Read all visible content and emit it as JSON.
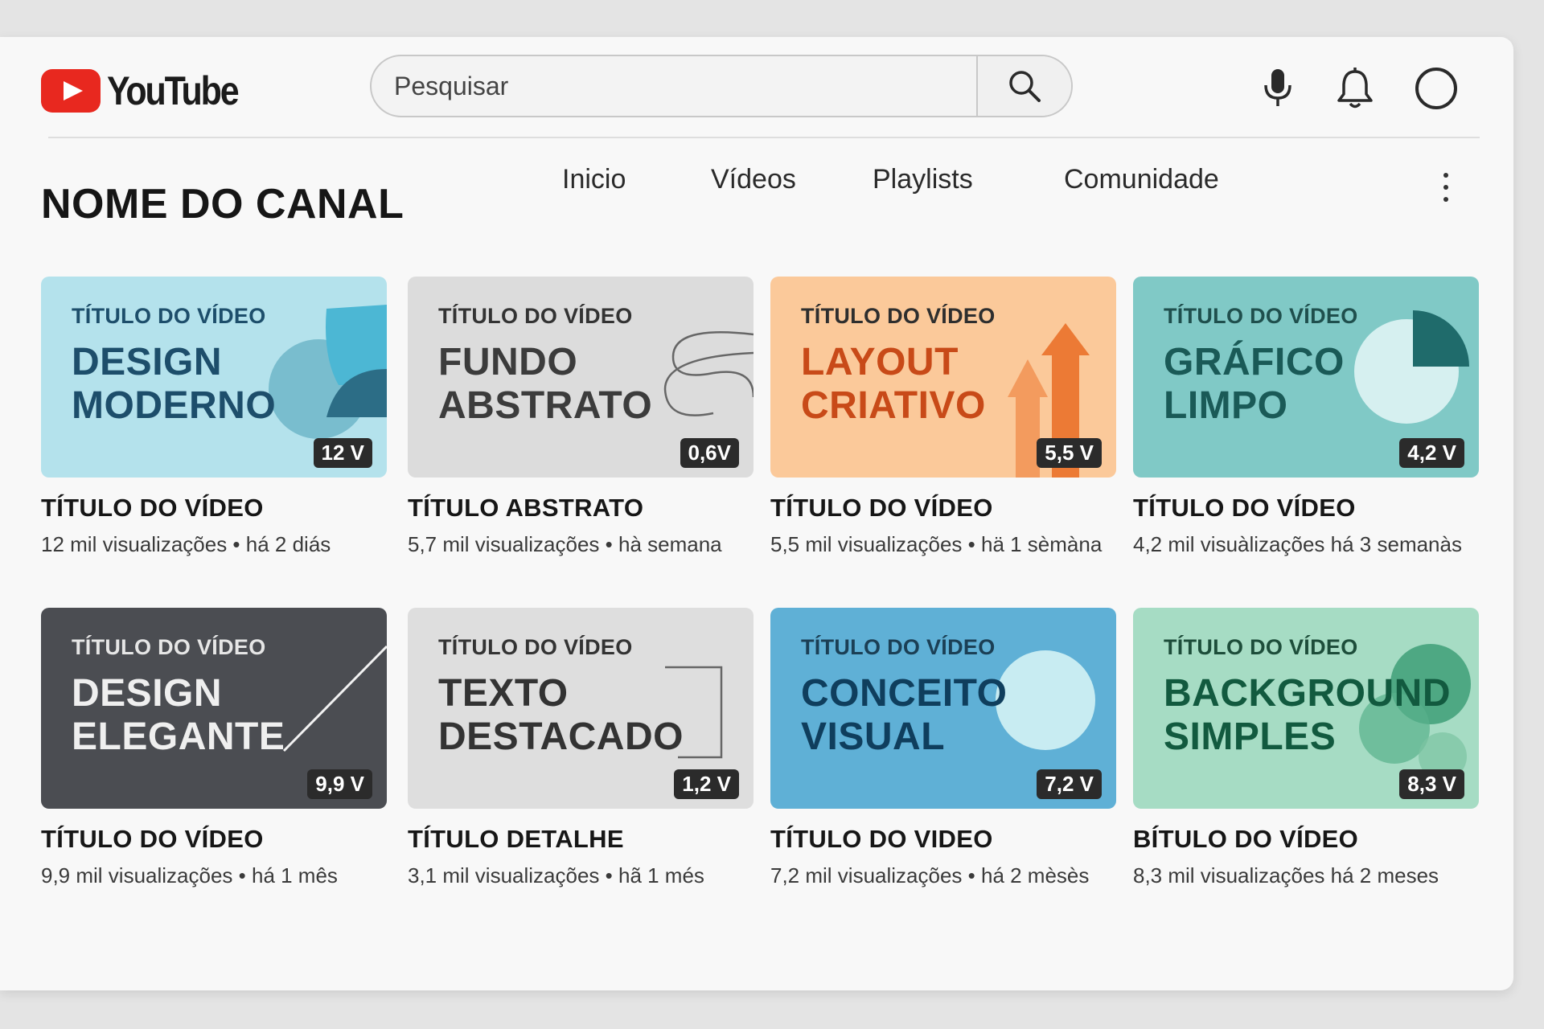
{
  "header": {
    "logo_text": "YouTube",
    "search_placeholder": "Pesquisar",
    "icons": [
      "microphone-icon",
      "bell-icon",
      "account-circle-icon"
    ]
  },
  "channel": {
    "name": "NOME DO CANAL",
    "tabs": [
      "Inicio",
      "Vídeos",
      "Playlists",
      "Comunidade"
    ]
  },
  "videos": [
    {
      "kicker": "TÍTULO DO VÍDEO",
      "headline": "DESIGN\nMODERNO",
      "duration": "12 V",
      "title": "TÍTULO DO VÍDEO",
      "meta": "12 mil visualizações  •  há 2 diás",
      "bg": "#b4e2ec",
      "fg": "#1d4e6b",
      "kicker_color": "#1d4e6b"
    },
    {
      "kicker": "TÍTULO DO VÍDEO",
      "headline": "FUNDO\nABSTRATO",
      "duration": "0,6V",
      "title": "TÍTULO ABSTRATO",
      "meta": "5,7 mil visualizações  •  hà semana",
      "bg": "#dcdcdc",
      "fg": "#3c3c3c",
      "kicker_color": "#333333"
    },
    {
      "kicker": "TÍTULO DO VÍDEO",
      "headline": "LAYOUT\nCRIATIVO",
      "duration": "5,5 V",
      "title": "TÍTULO DO VÍDEO",
      "meta": "5,5 mil visualizações  •  hä 1 sèmàna",
      "bg": "#fbc99a",
      "fg": "#c84a18",
      "kicker_color": "#2e2e2e"
    },
    {
      "kicker": "TÍTULO DO VÍDEO",
      "headline": "GRÁFICO\nLIMPO",
      "duration": "4,2 V",
      "title": "TÍTULO DO VÍDEO",
      "meta": "4,2 mil visuàlizações há 3 semanàs",
      "bg": "#80c9c6",
      "fg": "#1a5a57",
      "kicker_color": "#1f4f4d"
    },
    {
      "kicker": "TÍTULO DO VÍDEO",
      "headline": "DESIGN\nELEGANTE",
      "duration": "9,9 V",
      "title": "TÍTULO DO VÍDEO",
      "meta": "9,9 mil visualizações  •  há 1 mês",
      "bg": "#4b4d52",
      "fg": "#efefef",
      "kicker_color": "#e6e6e6"
    },
    {
      "kicker": "TÍTULO DO VÍDEO",
      "headline": "TEXTO\nDESTACADO",
      "duration": "1,2 V",
      "title": "TÍTULO DETALHE",
      "meta": "3,1 mil visualizações  •  hã 1 més",
      "bg": "#dedede",
      "fg": "#333333",
      "kicker_color": "#333333"
    },
    {
      "kicker": "TÍTULO DO VÍDEO",
      "headline": "CONCEITO\nVISUAL",
      "duration": "7,2 V",
      "title": "TÍTULO DO VIDEO",
      "meta": "7,2 mil visualizações  •  há 2 mèsès",
      "bg": "#5fb0d6",
      "fg": "#0f3e5d",
      "kicker_color": "#1b3f55"
    },
    {
      "kicker": "TÍTULO DO VÍDEO",
      "headline": "BACKGROUND\nSIMPLES",
      "duration": "8,3 V",
      "title": "BÍTULO DO VÍDEO",
      "meta": "8,3 mil visualizações  há 2 meses",
      "bg": "#a6dcc4",
      "fg": "#125a3f",
      "kicker_color": "#1d4d3a"
    }
  ],
  "colors": {
    "logo_red": "#e8281f",
    "page_bg": "#f8f8f8",
    "duration_badge": "#2b2b2b"
  }
}
